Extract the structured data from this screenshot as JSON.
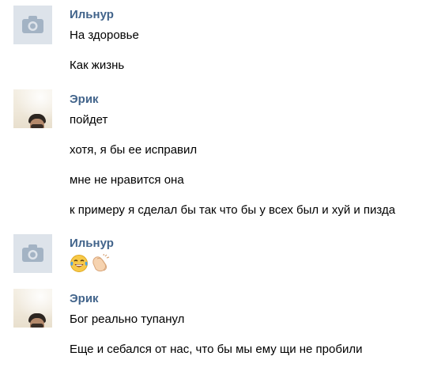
{
  "messages": [
    {
      "author": "Ильнур",
      "avatar": "camera-placeholder-icon",
      "lines": [
        "На здоровье",
        "Как жизнь"
      ]
    },
    {
      "author": "Эрик",
      "avatar": "user-photo",
      "lines": [
        "пойдет",
        "хотя, я бы ее исправил",
        "мне не нравится она",
        "к примеру я сделал бы так что бы у всех был и хуй и пизда"
      ]
    },
    {
      "author": "Ильнур",
      "avatar": "camera-placeholder-icon",
      "emojis": [
        "tears-of-joy-emoji",
        "clapping-hands-emoji"
      ]
    },
    {
      "author": "Эрик",
      "avatar": "user-photo",
      "lines": [
        "Бог реально тупанул",
        "Еще и себался от нас, что бы мы ему щи не пробили"
      ]
    }
  ],
  "colors": {
    "author_name": "#42648b",
    "message_text": "#000000",
    "placeholder_bg": "#dde3ea",
    "placeholder_icon": "#a3b3c4"
  }
}
